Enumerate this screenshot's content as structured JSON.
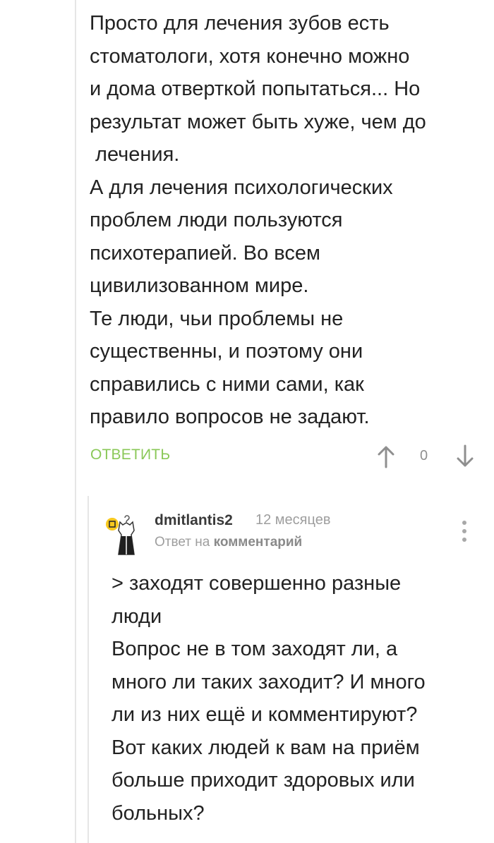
{
  "first_comment": {
    "lines": [
      "Просто для лечения зубов есть",
      "стоматологи, хотя конечно можно",
      "и дома отверткой попытаться... Но",
      "результат может быть хуже, чем до",
      " лечения.",
      "А для лечения психологических",
      "проблем люди пользуются",
      "психотерапией. Во всем",
      "цивилизованном мире.",
      "Те люди, чьи проблемы не",
      "существенны, и поэтому они",
      "справились с ними сами, как",
      "правило вопросов не задают."
    ],
    "reply_label": "ОТВЕТИТЬ",
    "rating": "0",
    "icons": {
      "upvote": "arrow-up-icon",
      "downvote": "arrow-down-icon"
    }
  },
  "reply_comment": {
    "author": "dmitlantis2",
    "time": "12 месяцев",
    "reply_prefix": "Ответ на",
    "reply_link": "комментарий",
    "lines": [
      "> заходят совершенно разные",
      "люди",
      "Вопрос не в том заходят ли, а",
      "много ли таких заходит? И много",
      "ли из них ещё и комментируют?",
      "Вот каких людей к вам на приём",
      "больше приходит здоровых или",
      "больных?"
    ],
    "icons": {
      "avatar": "avatar-icon",
      "badge": "badge-icon",
      "more": "more-vertical-icon"
    }
  },
  "colors": {
    "accent": "#8ac858",
    "text": "#222222",
    "muted": "#9e9e9e",
    "thread_line": "#e6e6e6",
    "badge": "#f7c81e"
  }
}
